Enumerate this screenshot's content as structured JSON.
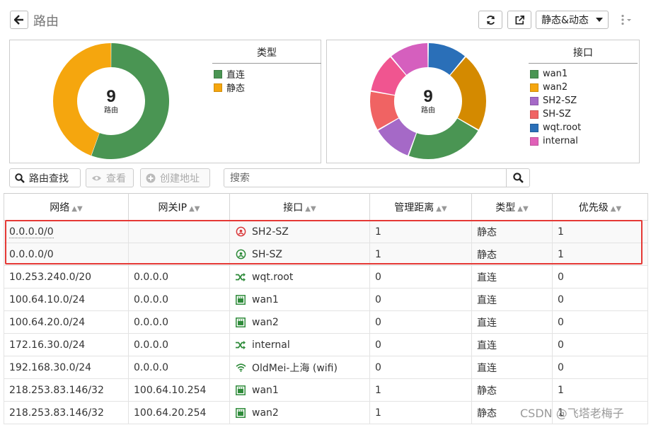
{
  "header": {
    "title": "路由",
    "mode_select": "静态&动态",
    "colors": {
      "border": "#bbbbbb"
    }
  },
  "charts": [
    {
      "center_value": "9",
      "center_label": "路由",
      "legend_title": "类型",
      "chart_data": {
        "type": "pie",
        "title": "",
        "categories": [
          "直连",
          "静态"
        ],
        "values": [
          5,
          4
        ],
        "colors": [
          "#4a9553",
          "#f5a60e"
        ],
        "donut": true,
        "legend_position": "right"
      }
    },
    {
      "center_value": "9",
      "center_label": "路由",
      "legend_title": "接口",
      "chart_data": {
        "type": "pie",
        "title": "",
        "categories": [
          "wan1",
          "wan2",
          "SH2-SZ",
          "SH-SZ",
          "wqt.root",
          "internal"
        ],
        "values": [
          2,
          2,
          1,
          1,
          1,
          1
        ],
        "slice_order": [
          "wqt.root",
          "wan2",
          "wan1",
          "SH2-SZ",
          "SH-SZ",
          "internal",
          "unlisted"
        ],
        "slice_values": [
          1,
          2,
          2,
          1,
          1,
          1,
          1
        ],
        "slice_colors": [
          "#2a6fb8",
          "#d48a00",
          "#4a9553",
          "#a569c7",
          "#f06363",
          "#f05590",
          "#d55fbe"
        ],
        "colors": [
          "#4a9553",
          "#f5a60e",
          "#a569c7",
          "#f06363",
          "#2a6fb8",
          "#e060b8"
        ],
        "donut": true,
        "legend_position": "right"
      }
    }
  ],
  "actions": {
    "lookup": "路由查找",
    "view": "查看",
    "create_address": "创建地址",
    "search_placeholder": "搜索"
  },
  "table": {
    "columns": [
      "网络",
      "网关IP",
      "接口",
      "管理距离",
      "类型",
      "优先级"
    ],
    "rows": [
      {
        "network": "0.0.0.0/0",
        "gateway": "",
        "iface": "SH2-SZ",
        "icon": "tunnel-down-icon",
        "distance": "1",
        "type": "静态",
        "priority": "1"
      },
      {
        "network": "0.0.0.0/0",
        "gateway": "",
        "iface": "SH-SZ",
        "icon": "tunnel-up-icon",
        "distance": "1",
        "type": "静态",
        "priority": "1"
      },
      {
        "network": "10.253.240.0/20",
        "gateway": "0.0.0.0",
        "iface": "wqt.root",
        "icon": "vdom-link-icon",
        "distance": "0",
        "type": "直连",
        "priority": "0"
      },
      {
        "network": "100.64.10.0/24",
        "gateway": "0.0.0.0",
        "iface": "wan1",
        "icon": "port-icon",
        "distance": "0",
        "type": "直连",
        "priority": "0"
      },
      {
        "network": "100.64.20.0/24",
        "gateway": "0.0.0.0",
        "iface": "wan2",
        "icon": "port-icon",
        "distance": "0",
        "type": "直连",
        "priority": "0"
      },
      {
        "network": "172.16.30.0/24",
        "gateway": "0.0.0.0",
        "iface": "internal",
        "icon": "vdom-link-icon",
        "distance": "0",
        "type": "直连",
        "priority": "0"
      },
      {
        "network": "192.168.30.0/24",
        "gateway": "0.0.0.0",
        "iface": "OldMei-上海 (wifi)",
        "icon": "wifi-icon",
        "distance": "0",
        "type": "直连",
        "priority": "0"
      },
      {
        "network": "218.253.83.146/32",
        "gateway": "100.64.10.254",
        "iface": "wan1",
        "icon": "port-icon",
        "distance": "1",
        "type": "静态",
        "priority": "1"
      },
      {
        "network": "218.253.83.146/32",
        "gateway": "100.64.20.254",
        "iface": "wan2",
        "icon": "port-icon",
        "distance": "1",
        "type": "静态",
        "priority": "1"
      }
    ]
  },
  "watermark": "CSDN @飞塔老梅子",
  "colors": {
    "highlight": "#e53935",
    "icon_green": "#2e8b3a",
    "icon_red": "#d9383a"
  }
}
